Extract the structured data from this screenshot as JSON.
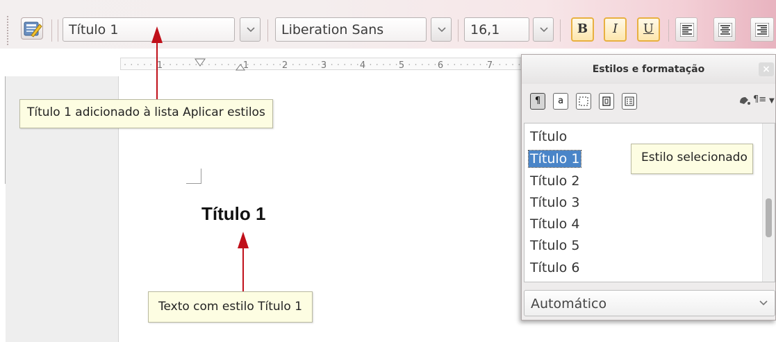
{
  "toolbar": {
    "apply_style_value": "Título 1",
    "font_name_value": "Liberation Sans",
    "font_size_value": "16,1",
    "bold_label": "B",
    "italic_label": "I",
    "underline_label": "U",
    "icons": [
      "styles-formatting-icon",
      "chevron-down-icon",
      "align-left-icon",
      "align-center-icon",
      "align-right-icon"
    ]
  },
  "ruler": {
    "numbers": [
      "1",
      "1",
      "2",
      "3",
      "4",
      "5",
      "6",
      "7"
    ]
  },
  "document": {
    "heading_text": "Título 1"
  },
  "callouts": {
    "apply_list": "Título 1 adicionado à lista Aplicar estilos",
    "selected_style": "Estilo selecionado",
    "heading_style": "Texto com estilo Título 1"
  },
  "panel": {
    "title": "Estilos e formatação",
    "close_label": "×",
    "family_buttons": [
      "¶",
      "a",
      "",
      "",
      ""
    ],
    "styles": [
      "Título",
      "Título 1",
      "Título 2",
      "Título 3",
      "Título 4",
      "Título 5",
      "Título 6"
    ],
    "selected_index": 1,
    "filter_value": "Automático"
  },
  "colors": {
    "accent_arrow": "#c0101a",
    "selection": "#4a85c8",
    "callout_bg": "#fdfde2"
  }
}
